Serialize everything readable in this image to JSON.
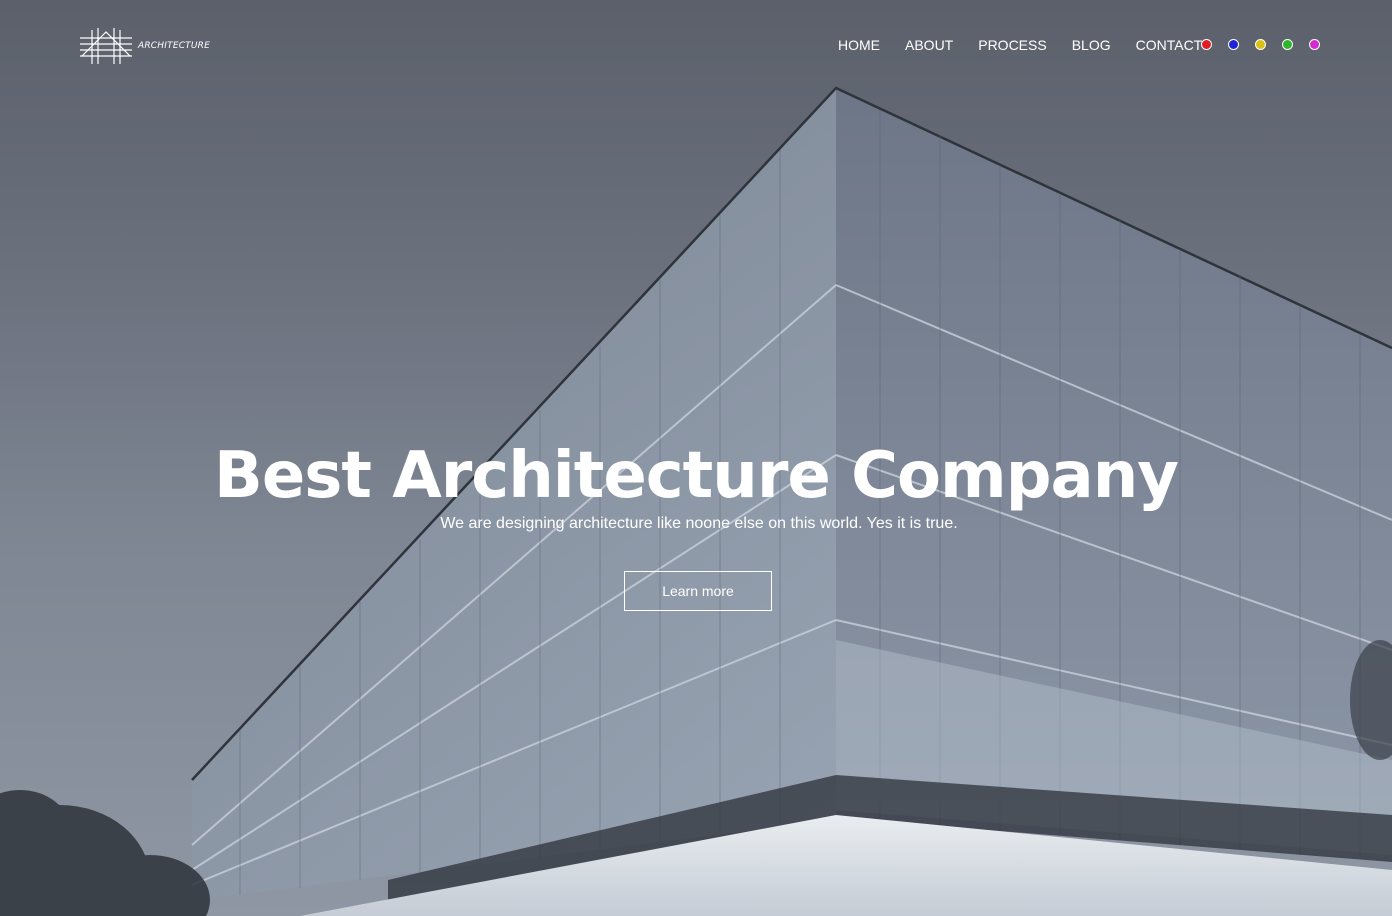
{
  "brand": {
    "name": "ARCHITECTURE",
    "icon": "building-sketch-logo"
  },
  "nav": {
    "items": [
      "HOME",
      "ABOUT",
      "PROCESS",
      "BLOG",
      "CONTACT"
    ]
  },
  "theme_swatches": {
    "colors": [
      "#e31b23",
      "#1f25d6",
      "#d7c215",
      "#2fb52b",
      "#d12bd1"
    ]
  },
  "hero": {
    "title": "Best Architecture Company",
    "subtitle": "We are designing architecture like noone else on this world. Yes it is true.",
    "cta_label": "Learn more"
  }
}
